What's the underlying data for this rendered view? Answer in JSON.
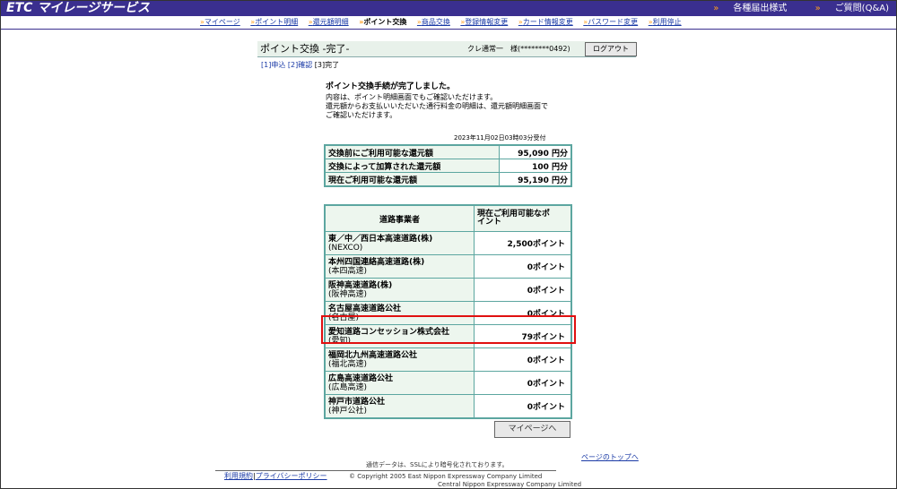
{
  "header": {
    "logo": "ETC マイレージサービス",
    "links": [
      "各種届出様式",
      "ご質問(Q&A)"
    ]
  },
  "nav": {
    "items": [
      {
        "label": "マイページ"
      },
      {
        "label": "ポイント明細"
      },
      {
        "label": "還元額明細"
      },
      {
        "label": "ポイント交換"
      },
      {
        "label": "商品交換"
      },
      {
        "label": "登録情報変更"
      },
      {
        "label": "カード情報変更"
      },
      {
        "label": "パスワード変更"
      },
      {
        "label": "利用停止"
      }
    ]
  },
  "page": {
    "title": "ポイント交換 -完了-",
    "user": "クレ通常一　様(********0492)",
    "logout": "ログアウト",
    "steps": {
      "s1": "[1]申込",
      "s2": "[2]確認",
      "s3": "[3]完了"
    },
    "message": {
      "head": "ポイント交換手続が完了しました。",
      "line1": "内容は、ポイント明細画面でもご確認いただけます。",
      "line2": "還元額からお支払いいただいた通行料金の明細は、還元額明細画面で",
      "line3": "ご確認いただけます。"
    },
    "timestamp": "2023年11月02日03時03分受付"
  },
  "summary": [
    {
      "label": "交換前にご利用可能な還元額",
      "value": "95,090 円分"
    },
    {
      "label": "交換によって加算された還元額",
      "value": "100 円分"
    },
    {
      "label": "現在ご利用可能な還元額",
      "value": "95,190 円分"
    }
  ],
  "operators": {
    "col1": "道路事業者",
    "col2a": "現在ご利用可能なポ",
    "col2b": "イント",
    "rows": [
      {
        "name": "東／中／西日本高速道路(株)",
        "sub": "(NEXCO)",
        "points": "2,500ポイント"
      },
      {
        "name": "本州四国連絡高速道路(株)",
        "sub": "(本四高速)",
        "points": "0ポイント"
      },
      {
        "name": "阪神高速道路(株)",
        "sub": "(阪神高速)",
        "points": "0ポイント"
      },
      {
        "name": "名古屋高速道路公社",
        "sub": "(名古屋)",
        "points": "0ポイント"
      },
      {
        "name": "愛知道路コンセッション株式会社",
        "sub": "(愛知)",
        "points": "79ポイント"
      },
      {
        "name": "福岡北九州高速道路公社",
        "sub": "(福北高速)",
        "points": "0ポイント"
      },
      {
        "name": "広島高速道路公社",
        "sub": "(広島高速)",
        "points": "0ポイント"
      },
      {
        "name": "神戸市道路公社",
        "sub": "(神戸公社)",
        "points": "0ポイント"
      }
    ]
  },
  "buttons": {
    "mypage": "マイページへ"
  },
  "footer": {
    "totop": "ページのトップへ",
    "ssl": "通信データは、SSLにより暗号化されております。",
    "terms": "利用規約",
    "privacy": "プライバシーポリシー",
    "copy1": "© Copyright 2005 East Nippon Expressway Company Limited",
    "copy2": "Central Nippon Expressway Company Limited"
  }
}
